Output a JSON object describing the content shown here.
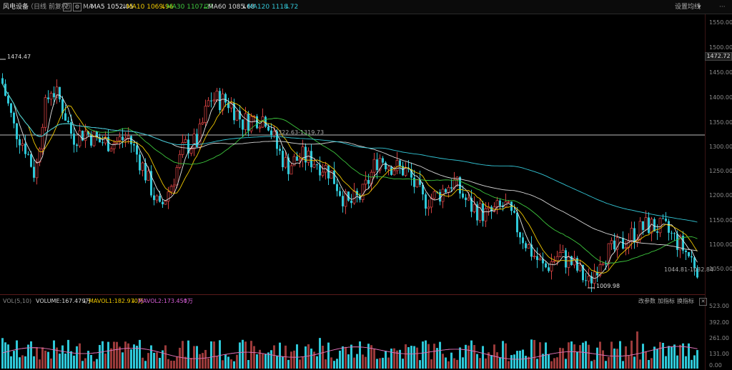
{
  "header": {
    "title": "风电设备",
    "mode": "（日线 前复权）",
    "help_icon": "?",
    "settings_icon": "gear-icon",
    "ma_label": "MA",
    "ma_items": [
      {
        "label": "MA5 1052.05",
        "color": "#e6e6e6"
      },
      {
        "label": "MA10 1069.96",
        "color": "#f0c800"
      },
      {
        "label": "MA30 1107.27",
        "color": "#3dc63d"
      },
      {
        "label": "MA60 1085.68",
        "color": "#d9d9d9"
      },
      {
        "label": "MA120 1118.72",
        "color": "#33c6d6"
      }
    ],
    "set_ma_button": "设置均线",
    "more_icon": "ellipsis-icon"
  },
  "price_axis": {
    "ticks": [
      "1550.00",
      "1500.00",
      "1450.00",
      "1400.00",
      "1350.00",
      "1300.00",
      "1250.00",
      "1200.00",
      "1150.00",
      "1100.00",
      "1050.00"
    ],
    "current_price": "1472.72"
  },
  "annotations": {
    "high": "1474.47",
    "low": "1009.98",
    "line_label": "1322.63-1319.73",
    "range_label": "1044.81-1032.84"
  },
  "volume": {
    "indicator": "VOL(5,10)",
    "items": [
      {
        "label": "VOLUME:167.479万",
        "color": "#d9d9d9"
      },
      {
        "label": "MAVOL1:182.970万",
        "color": "#f0c800"
      },
      {
        "label": "MAVOL2:173.450万",
        "color": "#d85fd8"
      }
    ],
    "buttons": [
      "改参数",
      "加指标",
      "换指标"
    ],
    "close_icon": "close-icon",
    "ticks": [
      "523.00",
      "392.00",
      "261.00",
      "131.00",
      "0.00"
    ]
  },
  "colors": {
    "up": "#d04040",
    "down": "#2ec8d8",
    "background": "#000000"
  }
}
